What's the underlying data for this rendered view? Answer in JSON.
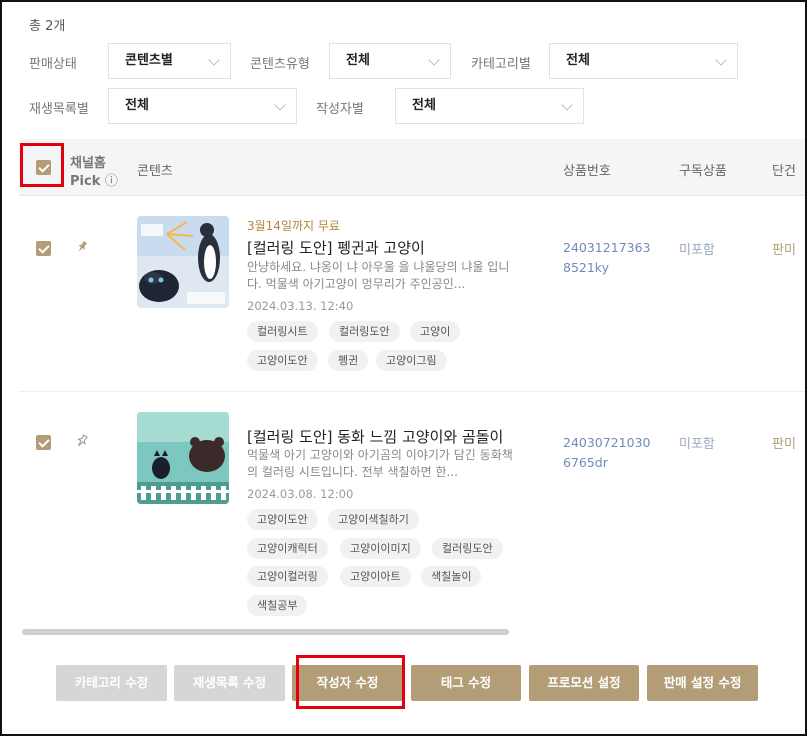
{
  "total_count": "총 2개",
  "filters": {
    "sale_status": {
      "label": "판매상태",
      "value": "콘텐츠별"
    },
    "content_type": {
      "label": "콘텐츠유형",
      "value": "전체"
    },
    "category": {
      "label": "카테고리별",
      "value": "전체"
    },
    "playlist": {
      "label": "재생목록별",
      "value": "전체"
    },
    "author": {
      "label": "작성자별",
      "value": "전체"
    }
  },
  "table": {
    "headers": {
      "channel_home": "채널홈",
      "pick": "Pick",
      "info_icon": "ⓘ",
      "content": "콘텐츠",
      "product_no": "상품번호",
      "subscription": "구독상품",
      "single": "단건"
    },
    "rows": [
      {
        "checked": true,
        "pinned": true,
        "free_label": "3월14일까지 무료",
        "title": "[컬러링 도안] 펭귄과 고양이",
        "desc": "안냥하세요. 냐옹이 냐 아우울 을 냐울당의 냐울 입니다. 먹물색 아기고양이 멍무리가 주인공인...",
        "date": "2024.03.13. 12:40",
        "tags": [
          "컬러링시트",
          "컬러링도안",
          "고양이",
          "고양이도안",
          "펭귄",
          "고양이그림"
        ],
        "product_no_1": "24031217363",
        "product_no_2": "8521ky",
        "subscription": "미포함",
        "sale": "판미"
      },
      {
        "checked": true,
        "pinned": false,
        "free_label": "",
        "title": "[컬러링 도안] 동화 느낌 고양이와 곰돌이",
        "desc": "먹물색 아기 고양이와 아기곰의 이야기가 담긴 동화책의 컬러링 시트입니다. 전부 색칠하면 한...",
        "date": "2024.03.08. 12:00",
        "tags": [
          "고양이도안",
          "고양이색칠하기",
          "고양이캐릭터",
          "고양이이미지",
          "컬러링도안",
          "고양이컬러링",
          "고양이아트",
          "색칠놀이",
          "색칠공부"
        ],
        "product_no_1": "24030721030",
        "product_no_2": "6765dr",
        "subscription": "미포함",
        "sale": "판미"
      }
    ]
  },
  "buttons": {
    "category_edit": "카테고리 수정",
    "playlist_edit": "재생목록 수정",
    "author_edit": "작성자 수정",
    "tag_edit": "태그 수정",
    "promotion_setting": "프로모션 설정",
    "sale_setting_edit": "판매 설정 수정"
  },
  "colors": {
    "accent": "#b29d77",
    "highlight": "#e3000f",
    "disabled": "#d6d6d6",
    "link": "#6f8cb9"
  }
}
